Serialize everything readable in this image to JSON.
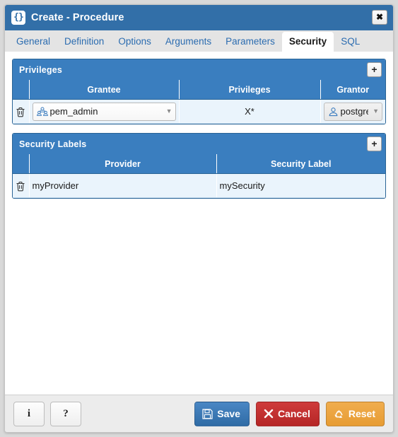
{
  "window": {
    "title": "Create - Procedure",
    "title_icon": "braces-icon",
    "close_label": "✖"
  },
  "tabs": [
    {
      "label": "General",
      "active": false
    },
    {
      "label": "Definition",
      "active": false
    },
    {
      "label": "Options",
      "active": false
    },
    {
      "label": "Arguments",
      "active": false
    },
    {
      "label": "Parameters",
      "active": false
    },
    {
      "label": "Security",
      "active": true
    },
    {
      "label": "SQL",
      "active": false
    }
  ],
  "privileges_panel": {
    "title": "Privileges",
    "add_label": "+",
    "columns": [
      "",
      "Grantee",
      "Privileges",
      "Grantor"
    ],
    "rows": [
      {
        "grantee": "pem_admin",
        "grantee_icon": "group-icon",
        "privileges": "X*",
        "grantor": "postgres",
        "grantor_icon": "user-icon",
        "caret": "▼"
      }
    ]
  },
  "security_labels_panel": {
    "title": "Security Labels",
    "add_label": "+",
    "columns": [
      "",
      "Provider",
      "Security Label"
    ],
    "rows": [
      {
        "provider": "myProvider",
        "security_label": "mySecurity"
      }
    ]
  },
  "footer": {
    "info_label": "i",
    "help_label": "?",
    "save_label": "Save",
    "cancel_label": "Cancel",
    "reset_label": "Reset"
  },
  "colors": {
    "titlebar": "#326fa8",
    "panel_header": "#3a7ebf",
    "row": "#eaf4fc",
    "tab_link": "#2b6cb0",
    "save": "#2f6ba5",
    "cancel": "#b52626",
    "reset": "#e79c33"
  }
}
